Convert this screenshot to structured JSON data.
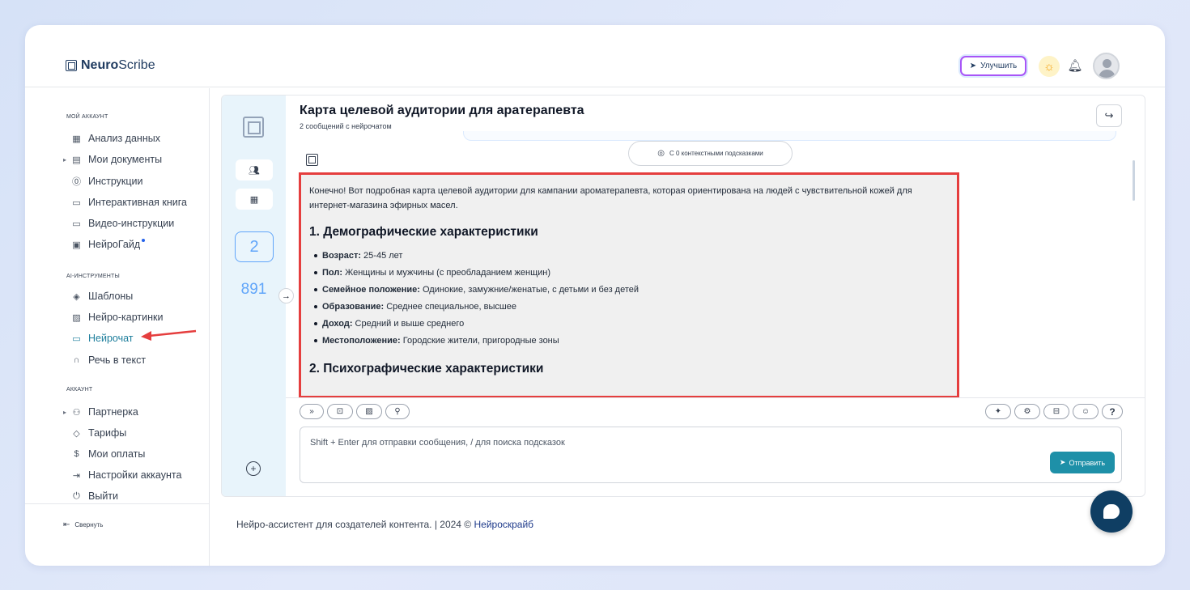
{
  "brand": {
    "bold": "Neuro",
    "light": "Scribe"
  },
  "topbar": {
    "upgrade_label": "Улучшить"
  },
  "sidebar": {
    "section_account": "МОЙ АККАУНТ",
    "items_account": [
      "Анализ данных",
      "Мои документы",
      "Инструкции",
      "Интерактивная книга",
      "Видео-инструкции",
      "НейроГайд"
    ],
    "section_ai": "AI-ИНСТРУМЕНТЫ",
    "items_ai": [
      "Шаблоны",
      "Нейро-картинки",
      "Нейрочат",
      "Речь в текст"
    ],
    "section_acc": "АККАУНТ",
    "items_acc": [
      "Партнерка",
      "Тарифы",
      "Мои оплаты",
      "Настройки аккаунта",
      "Выйти"
    ],
    "collapse_label": "Свернуть"
  },
  "rail": {
    "count": "2",
    "number": "891"
  },
  "chat": {
    "title": "Карта целевой аудитории для аратерапевта",
    "subtitle": "2 сообщений с нейрочатом",
    "hint_pill": "С 0 контекстными подсказками",
    "intro": "Конечно! Вот подробная карта целевой аудитории для кампании ароматерапевта, которая ориентирована на людей с чувствительной кожей для интернет-магазина эфирных масел.",
    "heading1": "1. Демографические характеристики",
    "items": [
      {
        "label": "Возраст:",
        "text": " 25-45 лет"
      },
      {
        "label": "Пол:",
        "text": " Женщины и мужчины (с преобладанием женщин)"
      },
      {
        "label": "Семейное положение:",
        "text": " Одинокие, замужние/женатые, с детьми и без детей"
      },
      {
        "label": "Образование:",
        "text": " Среднее специальное, высшее"
      },
      {
        "label": "Доход:",
        "text": " Средний и выше среднего"
      },
      {
        "label": "Местоположение:",
        "text": " Городские жители, пригородные зоны"
      }
    ],
    "heading2": "2. Психографические характеристики",
    "input_placeholder": "Shift + Enter для отправки сообщения, / для поиска подсказок",
    "send_label": "Отправить"
  },
  "footer": {
    "text": "Нейро-ассистент для создателей контента.  | 2024 © ",
    "link": "Нейроскрайб"
  },
  "colors": {
    "accent": "#1e90a8",
    "highlight": "#e53e3e",
    "rail": "#e8f4fb"
  }
}
